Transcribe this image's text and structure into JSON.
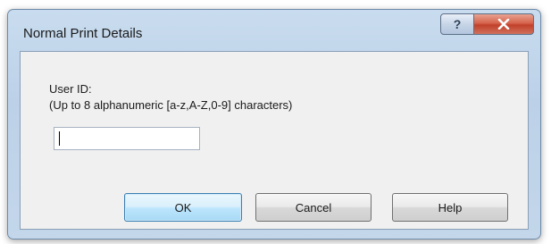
{
  "dialog": {
    "title": "Normal Print Details",
    "titlebar_buttons": {
      "help_glyph": "?",
      "close_icon": "close-icon"
    }
  },
  "form": {
    "user_id_label": "User ID:",
    "user_id_hint": "(Up to 8 alphanumeric [a-z,A-Z,0-9] characters)",
    "user_id_value": ""
  },
  "buttons": {
    "ok": "OK",
    "cancel": "Cancel",
    "help": "Help"
  },
  "colors": {
    "frame": "#c3d6ea",
    "close_button": "#c9452e",
    "default_button_border": "#3c7fb1"
  }
}
